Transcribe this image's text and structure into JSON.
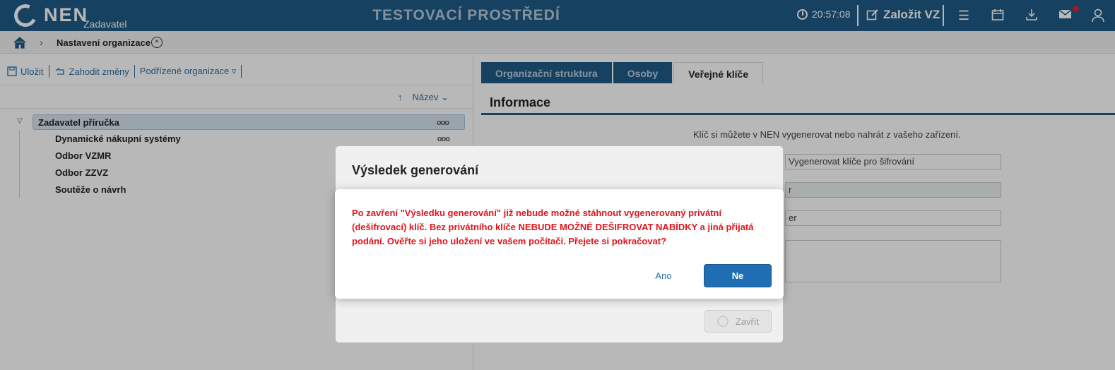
{
  "header": {
    "logo_text": "NEN",
    "logo_sub": "Zadavatel",
    "environment": "TESTOVACÍ PROSTŘEDÍ",
    "clock": "20:57:08",
    "create_label": "Založit VZ",
    "icons": [
      "menu-icon",
      "calendar-icon",
      "download-icon",
      "mail-icon",
      "user-icon"
    ]
  },
  "breadcrumb": {
    "current": "Nastavení organizace"
  },
  "left": {
    "toolbar": {
      "save": "Uložit",
      "discard": "Zahodit změny",
      "sub_orgs": "Podřízené organizace ▿"
    },
    "sort_label": "Název",
    "tree": [
      {
        "label": "Zadavatel příručka",
        "menu": "ooo"
      },
      {
        "label": "Dynamické nákupní systémy",
        "menu": "ooo"
      },
      {
        "label": "Odbor VZMR"
      },
      {
        "label": "Odbor ZZVZ"
      },
      {
        "label": "Soutěže o návrh"
      }
    ]
  },
  "right": {
    "tabs": [
      "Organizační struktura",
      "Osoby",
      "Veřejné klíče"
    ],
    "info_title": "Informace",
    "info_text": "Klíč si můžete v NEN vygenerovat nebo nahrát z vašeho zařízení.",
    "field_generate": "Vygenerovat klíče pro šifrování",
    "field_2": "r",
    "field_3": "er"
  },
  "dialog": {
    "title": "Výsledek generování",
    "close_label": "Zavřít"
  },
  "confirm": {
    "message": "Po zavření \"Výsledku generování\" již nebude možné stáhnout vygenerovaný privátní (dešifrovací) klíč. Bez privátního klíče NEBUDE MOŽNÉ DEŠIFROVAT NABÍDKY a jiná přijatá podání. Ověřte si jeho uložení ve vašem počítači. Přejete si pokračovat?",
    "yes": "Ano",
    "no": "Ne"
  },
  "colors": {
    "header_blue": "#1f5a86",
    "accent_blue": "#1f6eb4",
    "warning_red": "#e0141c"
  }
}
